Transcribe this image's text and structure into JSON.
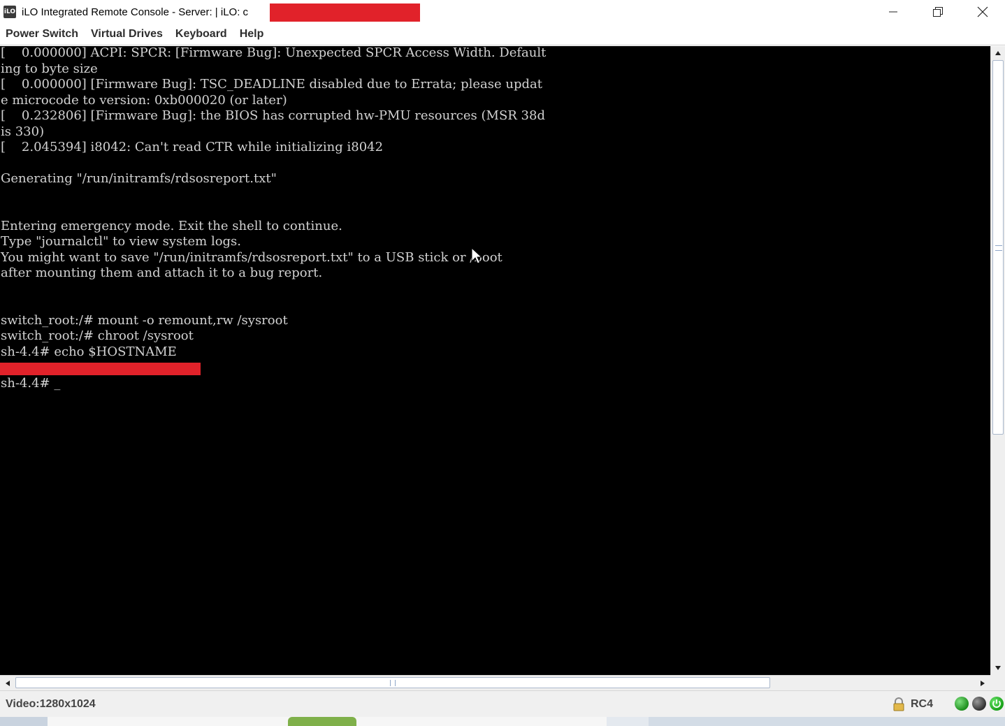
{
  "window": {
    "title": "iLO Integrated Remote Console - Server:  | iLO: c",
    "app_icon_text": "iLO",
    "controls": [
      "minimize-icon",
      "restore-icon",
      "close-icon"
    ]
  },
  "menu": {
    "items": [
      "Power Switch",
      "Virtual Drives",
      "Keyboard",
      "Help"
    ]
  },
  "console": {
    "lines": [
      "[    0.000000] ACPI: SPCR: [Firmware Bug]: Unexpected SPCR Access Width. Default",
      "ing to byte size",
      "[    0.000000] [Firmware Bug]: TSC_DEADLINE disabled due to Errata; please updat",
      "e microcode to version: 0xb000020 (or later)",
      "[    0.232806] [Firmware Bug]: the BIOS has corrupted hw-PMU resources (MSR 38d",
      "is 330)",
      "[    2.045394] i8042: Can't read CTR while initializing i8042",
      "",
      "Generating \"/run/initramfs/rdsosreport.txt\"",
      "",
      "",
      "Entering emergency mode. Exit the shell to continue.",
      "Type \"journalctl\" to view system logs.",
      "You might want to save \"/run/initramfs/rdsosreport.txt\" to a USB stick or /boot",
      "after mounting them and attach it to a bug report.",
      "",
      "",
      "switch_root:/# mount -o remount,rw /sysroot",
      "switch_root:/# chroot /sysroot",
      "sh-4.4# echo $HOSTNAME",
      "",
      "sh-4.4# _"
    ],
    "text_color": "#d2d2d2",
    "background": "#000000"
  },
  "status": {
    "video": "Video:1280x1024",
    "encryption": "RC4",
    "icons": [
      "lock-icon",
      "status-led-green",
      "status-led-gray",
      "power-icon"
    ]
  },
  "colors": {
    "redaction": "#e1222a",
    "menu_text": "#2d2d2d"
  }
}
